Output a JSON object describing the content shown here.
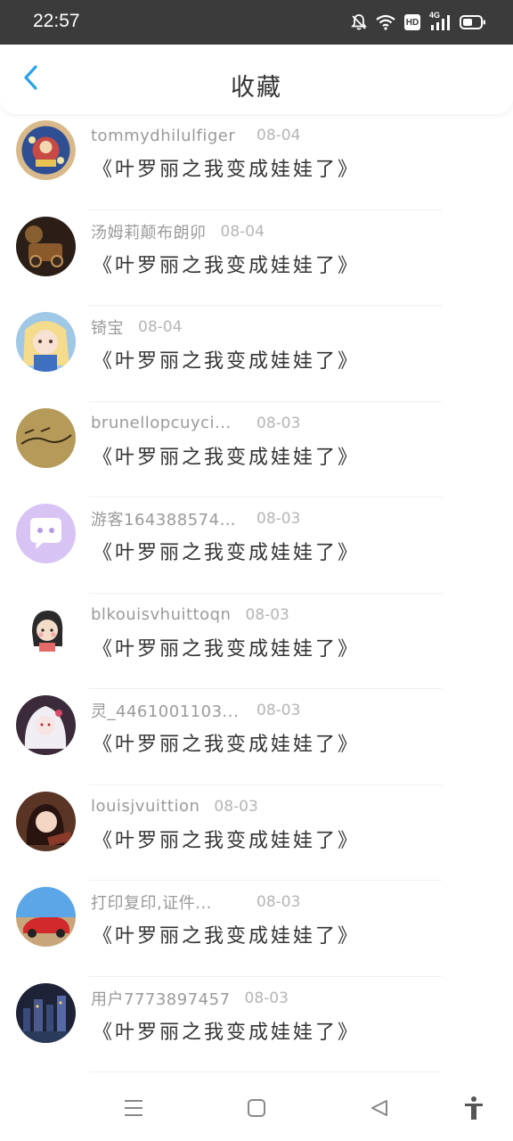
{
  "status_bar": {
    "time": "22:57",
    "icons": [
      "bell-off-icon",
      "wifi-icon",
      "hd-icon",
      "signal-4g-icon",
      "battery-icon"
    ],
    "hd_label": "HD",
    "net_label": "4G"
  },
  "header": {
    "title": "收藏",
    "back_icon": "chevron-left-icon",
    "accent_color": "#2aa3e8"
  },
  "favorites": [
    {
      "username": "tommydhilulfiger",
      "date": "08-04",
      "content": "《叶罗丽之我变成娃娃了》"
    },
    {
      "username": "汤姆莉颠布朗卯",
      "date": "08-04",
      "content": "《叶罗丽之我变成娃娃了》"
    },
    {
      "username": "锜宝",
      "date": "08-04",
      "content": "《叶罗丽之我变成娃娃了》"
    },
    {
      "username": "brunellopcuyci...",
      "date": "08-03",
      "content": "《叶罗丽之我变成娃娃了》"
    },
    {
      "username": "游客1643885742...",
      "date": "08-03",
      "content": "《叶罗丽之我变成娃娃了》"
    },
    {
      "username": "blkouisvhuittoqn",
      "date": "08-03",
      "content": "《叶罗丽之我变成娃娃了》"
    },
    {
      "username": "灵_4461001103...",
      "date": "08-03",
      "content": "《叶罗丽之我变成娃娃了》"
    },
    {
      "username": "louisjvuittion",
      "date": "08-03",
      "content": "《叶罗丽之我变成娃娃了》"
    },
    {
      "username": "打印复印,证件...",
      "date": "08-03",
      "content": "《叶罗丽之我变成娃娃了》"
    },
    {
      "username": "用户7773897457",
      "date": "08-03",
      "content": "《叶罗丽之我变成娃娃了》"
    }
  ],
  "nav_bar": {
    "icons": [
      "menu-icon",
      "home-square-icon",
      "back-triangle-icon",
      "accessibility-icon"
    ]
  }
}
